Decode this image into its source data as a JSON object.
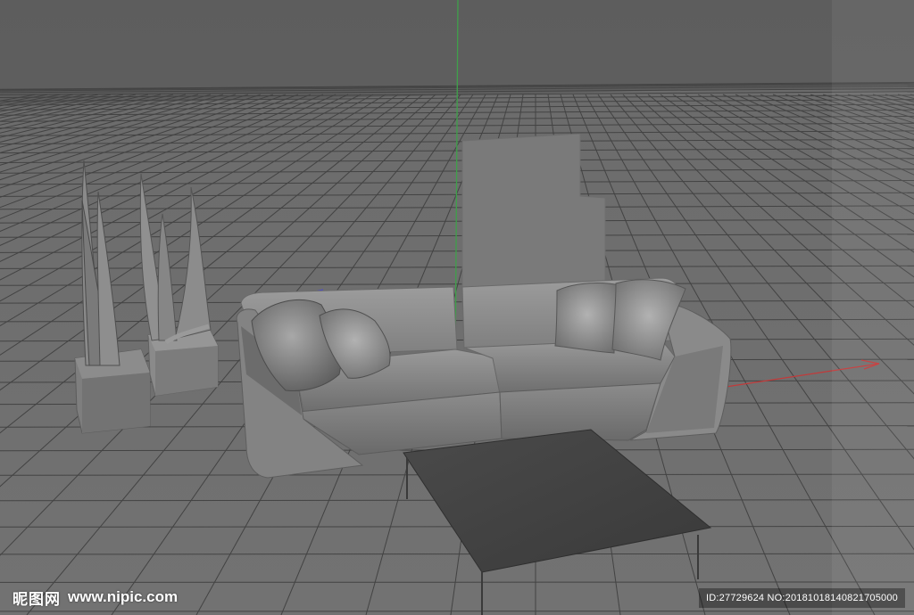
{
  "viewport": {
    "background_color": "#5b5b5b",
    "grid_color": "#3f3f3f",
    "floor_color": "#686868",
    "axis_colors": {
      "y": "#3fa04a",
      "x": "#c23a3a",
      "z": "#4a4ad0"
    }
  },
  "scene_objects": [
    "sofa",
    "pillow",
    "pillow",
    "pillow",
    "pillow",
    "coffee-table",
    "potted-plant",
    "potted-plant",
    "wall-panel"
  ],
  "watermark": {
    "brand": "昵图网",
    "site": "www.nipic.com",
    "id_text": "ID:27729624 NO:20181018140821705000"
  }
}
